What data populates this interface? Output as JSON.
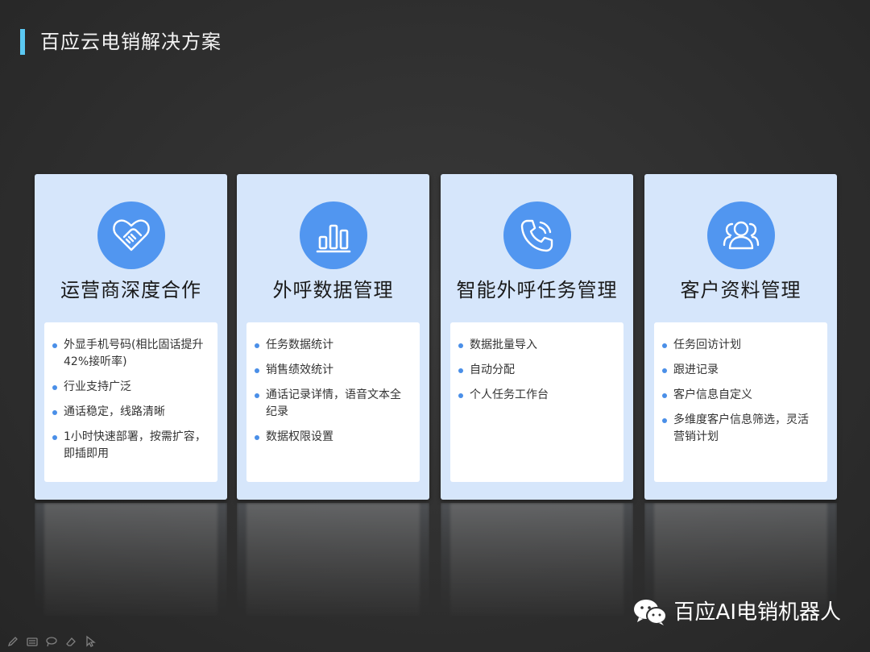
{
  "slide": {
    "title": "百应云电销解决方案"
  },
  "cards": [
    {
      "icon": "handshake-heart-icon",
      "title": "运营商深度合作",
      "items": [
        "外显手机号码(相比固话提升42%接听率)",
        "行业支持广泛",
        "通话稳定，线路清晰",
        "1小时快速部署，按需扩容，即插即用"
      ]
    },
    {
      "icon": "bar-chart-icon",
      "title": "外呼数据管理",
      "items": [
        "任务数据统计",
        "销售绩效统计",
        "通话记录详情，语音文本全纪录",
        "数据权限设置"
      ]
    },
    {
      "icon": "phone-call-icon",
      "title": "智能外呼任务管理",
      "items": [
        "数据批量导入",
        "自动分配",
        "个人任务工作台"
      ]
    },
    {
      "icon": "users-group-icon",
      "title": "客户资料管理",
      "items": [
        "任务回访计划",
        "跟进记录",
        "客户信息自定义",
        "多维度客户信息筛选，灵活营销计划"
      ]
    }
  ],
  "watermark": {
    "text": "百应AI电销机器人",
    "icon": "wechat-icon"
  },
  "toolbar": {
    "icons": [
      "pen-icon",
      "keyboard-icon",
      "lasso-icon",
      "eraser-icon",
      "pointer-icon"
    ]
  },
  "colors": {
    "accent_bar": "#5bc8f2",
    "icon_circle": "#5196f0",
    "card_bg": "#d6e6fb",
    "bullet": "#4a8fe8"
  }
}
